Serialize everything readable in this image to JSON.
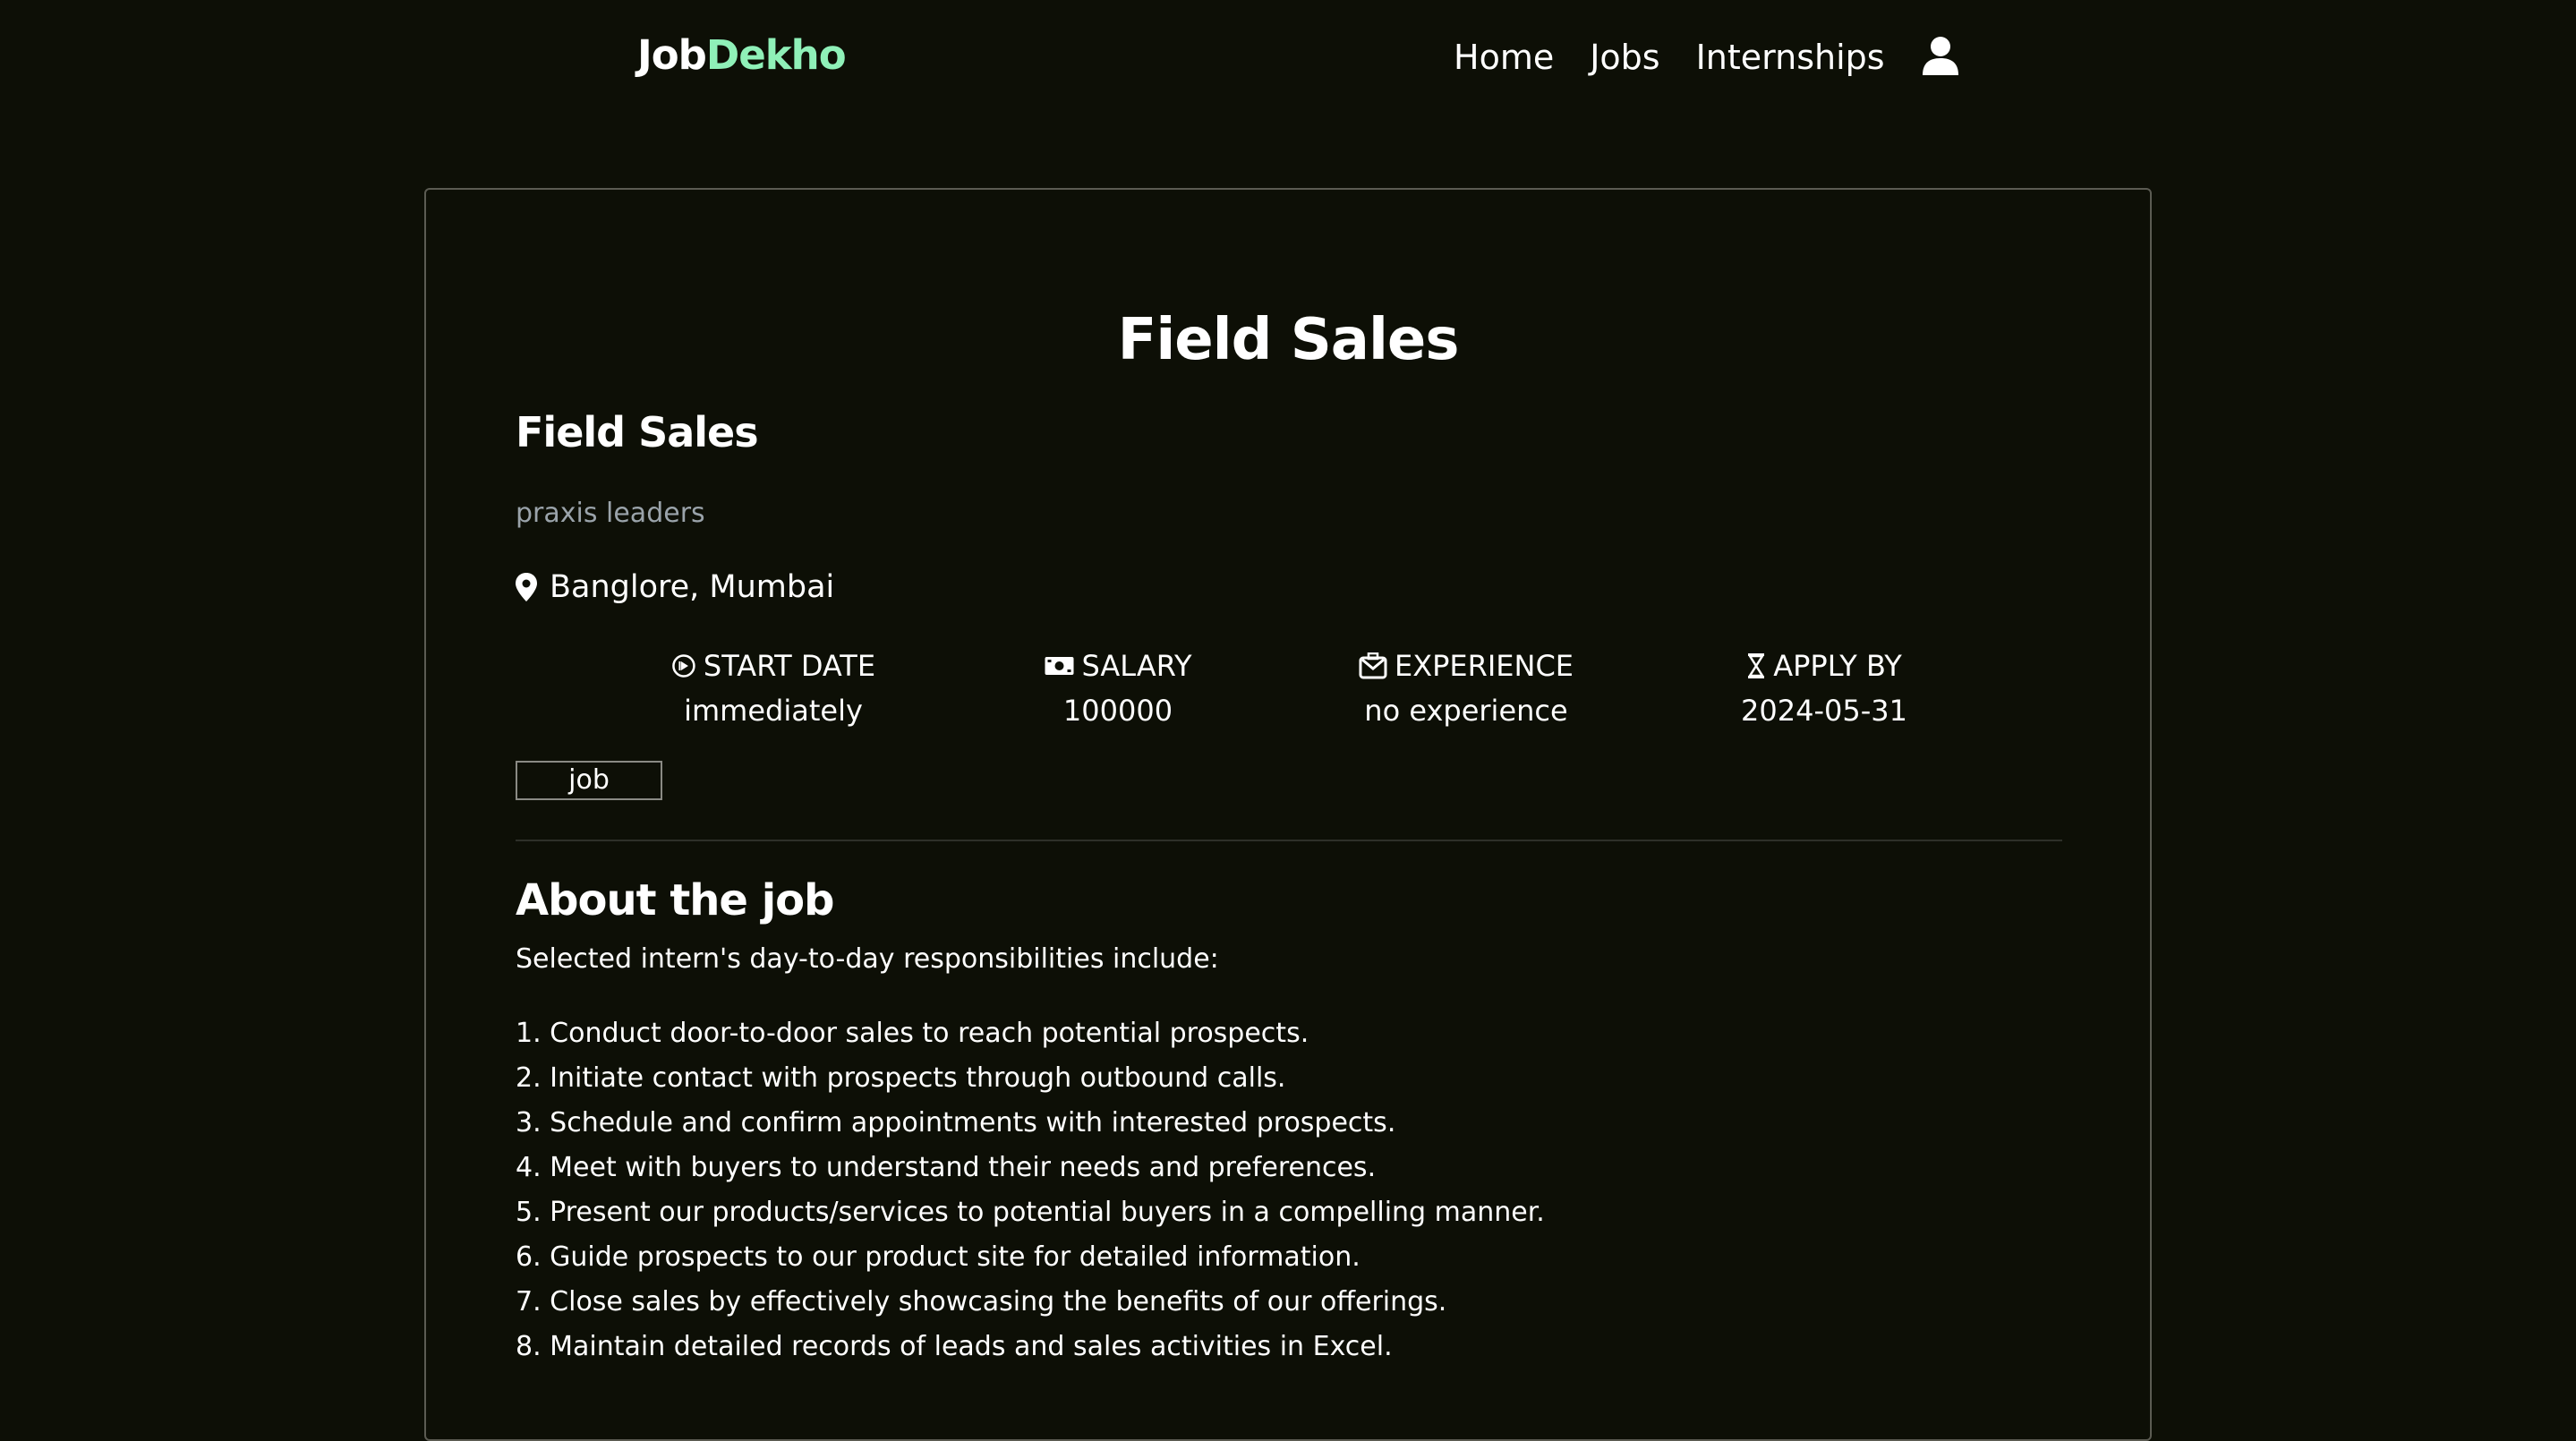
{
  "brand": {
    "part1": "Job",
    "part2": "Dekho"
  },
  "nav": {
    "links": [
      "Home",
      "Jobs",
      "Internships"
    ]
  },
  "page": {
    "title": "Field Sales"
  },
  "job": {
    "title": "Field Sales",
    "company": "praxis leaders",
    "location": "Banglore, Mumbai",
    "meta": [
      {
        "label": "START DATE",
        "value": "immediately",
        "icon": "play-circle-icon"
      },
      {
        "label": "SALARY",
        "value": "100000",
        "icon": "money-icon"
      },
      {
        "label": "EXPERIENCE",
        "value": "no experience",
        "icon": "briefcase-icon"
      },
      {
        "label": "APPLY BY",
        "value": "2024-05-31",
        "icon": "hourglass-icon"
      }
    ],
    "tag": "job"
  },
  "about": {
    "heading": "About the job",
    "intro": "Selected intern's day-to-day responsibilities include:",
    "responsibilities": [
      "1. Conduct door-to-door sales to reach potential prospects.",
      "2. Initiate contact with prospects through outbound calls.",
      "3. Schedule and confirm appointments with interested prospects.",
      "4. Meet with buyers to understand their needs and preferences.",
      "5. Present our products/services to potential buyers in a compelling manner.",
      "6. Guide prospects to our product site for detailed information.",
      "7. Close sales by effectively showcasing the benefits of our offerings.",
      "8. Maintain detailed records of leads and sales activities in Excel."
    ]
  },
  "colors": {
    "background": "#0d0f06",
    "brand_accent": "#8ff0b8",
    "muted_text": "#9aa3aa"
  }
}
